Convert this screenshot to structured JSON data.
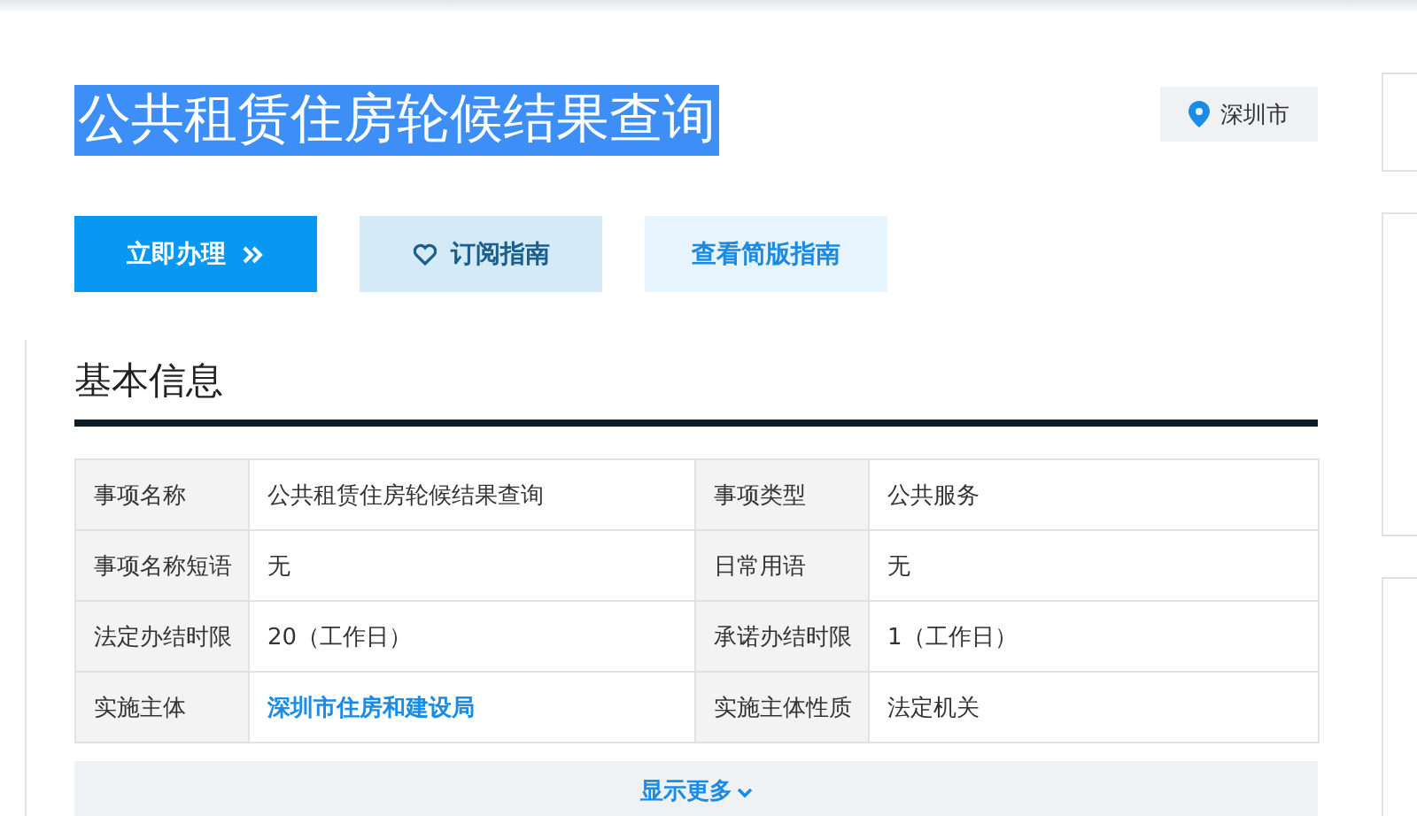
{
  "title": {
    "text": "公共租赁住房轮候结果查询",
    "highlighted": true
  },
  "location": {
    "text": "深圳市"
  },
  "buttons": [
    {
      "kind": "primary",
      "label": "立即办理"
    },
    {
      "kind": "secondary",
      "label": "订阅指南"
    },
    {
      "kind": "light",
      "label": "查看简版指南"
    }
  ],
  "section": {
    "heading": "基本信息"
  },
  "table": {
    "rows": [
      [
        {
          "label": "事项名称"
        },
        {
          "kind": "text",
          "value": "公共租赁住房轮候结果查询"
        },
        {
          "label": "事项类型"
        },
        {
          "kind": "text",
          "value": "公共服务"
        }
      ],
      [
        {
          "label": "事项名称短语"
        },
        {
          "kind": "text",
          "value": "无"
        },
        {
          "label": "日常用语"
        },
        {
          "kind": "text",
          "value": "无"
        }
      ],
      [
        {
          "label": "法定办结时限"
        },
        {
          "kind": "text",
          "value": "20（工作日）"
        },
        {
          "label": "承诺办结时限"
        },
        {
          "kind": "text",
          "value": "1（工作日）"
        }
      ],
      [
        {
          "label": "实施主体"
        },
        {
          "kind": "link",
          "value": "深圳市住房和建设局"
        },
        {
          "label": "实施主体性质"
        },
        {
          "kind": "text",
          "value": "法定机关"
        }
      ]
    ]
  },
  "show_more": {
    "label": "显示更多"
  }
}
